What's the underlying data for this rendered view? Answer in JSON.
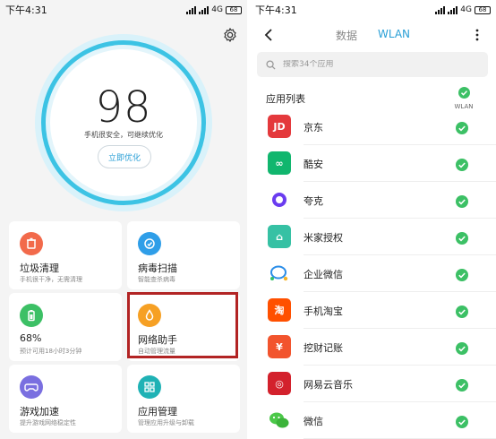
{
  "left": {
    "status": {
      "time": "下午4:31",
      "network": "4G",
      "battery": "68"
    },
    "score": {
      "value": "98",
      "description": "手机很安全，可继续优化",
      "button": "立即优化"
    },
    "cards": [
      {
        "title": "垃圾清理",
        "subtitle": "手机很干净，无需清理",
        "icon": "trash-icon",
        "color": "#f26a4b"
      },
      {
        "title": "病毒扫描",
        "subtitle": "智能查杀病毒",
        "icon": "clock-check-icon",
        "color": "#2f9ee8"
      },
      {
        "title": "68%",
        "subtitle": "预计可用18小时3分钟",
        "icon": "battery-icon",
        "color": "#3cc065"
      },
      {
        "title": "网络助手",
        "subtitle": "自动管理流量",
        "icon": "drop-icon",
        "color": "#f6a024"
      },
      {
        "title": "游戏加速",
        "subtitle": "提升游戏网络稳定性",
        "icon": "gamepad-icon",
        "color": "#7a6fe0"
      },
      {
        "title": "应用管理",
        "subtitle": "管理应用升级与卸载",
        "icon": "grid-icon",
        "color": "#1fb2b5"
      }
    ]
  },
  "right": {
    "status": {
      "time": "下午4:31",
      "network": "4G",
      "battery": "68"
    },
    "nav": {
      "tabs": [
        "数据",
        "WLAN"
      ],
      "active_tab": "WLAN"
    },
    "search": {
      "placeholder": "搜索34个应用"
    },
    "list_header": "应用列表",
    "column_header": "WLAN",
    "accent": "#2a9fd6",
    "check_color": "#3cc065",
    "apps": [
      {
        "name": "京东",
        "icon": "jd-icon",
        "color": "#e4393c",
        "glyph": "JD"
      },
      {
        "name": "酷安",
        "icon": "coolapk-icon",
        "color": "#11b66e",
        "glyph": "∞"
      },
      {
        "name": "夸克",
        "icon": "quark-icon",
        "color": "#ffffff",
        "glyph": ""
      },
      {
        "name": "米家授权",
        "icon": "mijia-icon",
        "color": "#36c1a4",
        "glyph": "⌂"
      },
      {
        "name": "企业微信",
        "icon": "wecom-icon",
        "color": "#ffffff",
        "glyph": ""
      },
      {
        "name": "手机淘宝",
        "icon": "taobao-icon",
        "color": "#ff5000",
        "glyph": "淘"
      },
      {
        "name": "挖财记账",
        "icon": "wacai-icon",
        "color": "#f2542d",
        "glyph": "¥"
      },
      {
        "name": "网易云音乐",
        "icon": "netease-music-icon",
        "color": "#d3212c",
        "glyph": "◎"
      },
      {
        "name": "微信",
        "icon": "wechat-icon",
        "color": "#ffffff",
        "glyph": ""
      }
    ]
  }
}
